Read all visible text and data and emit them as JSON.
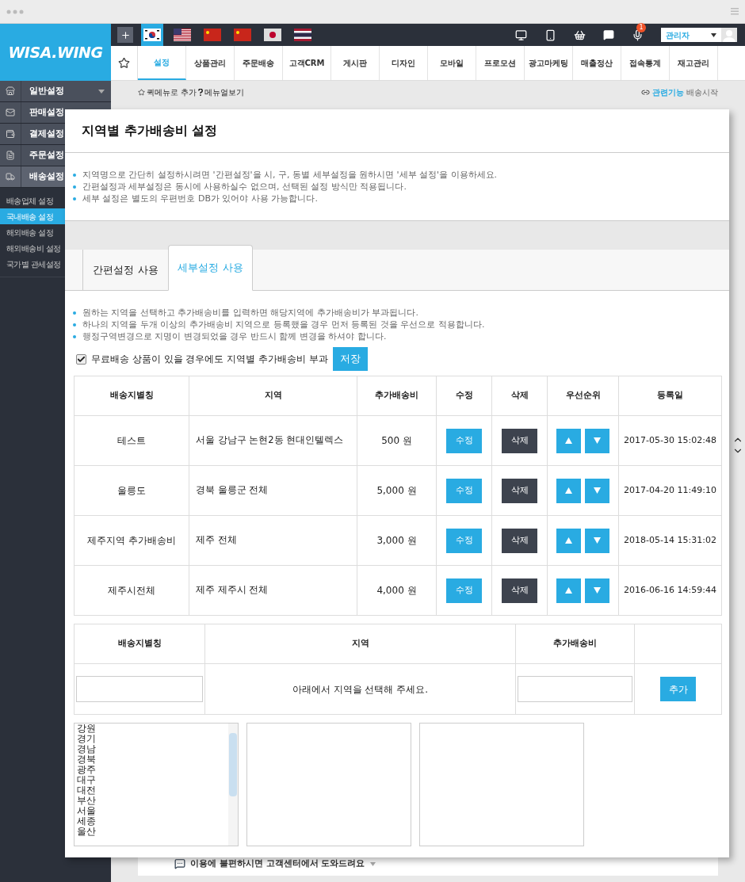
{
  "logo": "WISA.WING",
  "flags": [
    {
      "kind": "kr",
      "selected": true
    },
    {
      "kind": "us",
      "selected": false
    },
    {
      "kind": "cn",
      "selected": false
    },
    {
      "kind": "cn",
      "selected": false
    },
    {
      "kind": "jp",
      "selected": false
    },
    {
      "kind": "th",
      "selected": false
    }
  ],
  "notification_count": "1",
  "admin_select": {
    "value": "관리자"
  },
  "menu_tabs": [
    {
      "label": "설정",
      "selected": true
    },
    {
      "label": "상품관리",
      "selected": false
    },
    {
      "label": "주문배송",
      "selected": false
    },
    {
      "label": "고객CRM",
      "selected": false
    },
    {
      "label": "게시판",
      "selected": false
    },
    {
      "label": "디자인",
      "selected": false
    },
    {
      "label": "모바일",
      "selected": false
    },
    {
      "label": "프로모션",
      "selected": false
    },
    {
      "label": "광고마케팅",
      "selected": false
    },
    {
      "label": "매출정산",
      "selected": false
    },
    {
      "label": "접속통계",
      "selected": false
    },
    {
      "label": "재고관리",
      "selected": false
    }
  ],
  "quick_menu": {
    "add": "퀵메뉴로 추가",
    "help": "메뉴얼보기"
  },
  "related": {
    "label": "관련기능",
    "link": "배송시작"
  },
  "sidebar": {
    "items": [
      {
        "kind": "store",
        "label": "일반설정",
        "selected": false
      },
      {
        "kind": "mail",
        "label": "판매설정",
        "selected": false
      },
      {
        "kind": "wallet",
        "label": "결제설정",
        "selected": false
      },
      {
        "kind": "doc",
        "label": "주문설정",
        "selected": false
      },
      {
        "kind": "truck",
        "label": "배송설정",
        "selected": true
      }
    ],
    "sub_items": [
      {
        "label": "배송업체 설정",
        "selected": false
      },
      {
        "label": "국내배송 설정",
        "selected": true
      },
      {
        "label": "해외배송 설정",
        "selected": false
      },
      {
        "label": "해외배송비 설정",
        "selected": false
      },
      {
        "label": "국가별 관세설정",
        "selected": false
      }
    ]
  },
  "modal": {
    "title": "지역별 추가배송비 설정",
    "notes": [
      "지역명으로 간단히 설정하시려면 '간편설정'을 시, 구, 동별 세부설정을 원하시면 '세부 설정'을 이용하세요.",
      "간편설정과 세부설정은 동시에 사용하실수 없으며, 선택된 설정 방식만 적용됩니다.",
      "세부 설정은 별도의 우편번호 DB가 있어야 사용 가능합니다."
    ],
    "tabs": [
      {
        "label": "간편설정 사용",
        "selected": false
      },
      {
        "label": "세부설정 사용",
        "selected": true
      }
    ],
    "tab_notes": [
      "원하는 지역을 선택하고 추가배송비를 입력하면 해당지역에 추가배송비가 부과됩니다.",
      "하나의 지역을 두개 이상의 추가배송비 지역으로 등록했을 경우 먼저 등록된 것을 우선으로 적용합니다.",
      "행정구역변경으로 지명이 변경되었을 경우 반드시 함께 변경을 하셔야 합니다."
    ],
    "free_shipping_option": {
      "label": "무료배송 상품이 있을 경우에도 지역별 추가배송비 부과",
      "checked": true
    },
    "save_button": "저장",
    "table": {
      "columns": [
        "배송지별칭",
        "지역",
        "추가배송비",
        "수정",
        "삭제",
        "우선순위",
        "등록일"
      ],
      "rows": [
        {
          "alias": "테스트",
          "region": "서울 강남구 논현2동 현대인텔렉스",
          "fee": "500 원",
          "edit": "수정",
          "delete": "삭제",
          "date": "2017-05-30 15:02:48"
        },
        {
          "alias": "울릉도",
          "region": "경북 울릉군 전체",
          "fee": "5,000 원",
          "edit": "수정",
          "delete": "삭제",
          "date": "2017-04-20 11:49:10"
        },
        {
          "alias": "제주지역 추가배송비",
          "region": "제주 전체",
          "fee": "3,000 원",
          "edit": "수정",
          "delete": "삭제",
          "date": "2018-05-14 15:31:02"
        },
        {
          "alias": "제주시전체",
          "region": "제주 제주시 전체",
          "fee": "4,000 원",
          "edit": "수정",
          "delete": "삭제",
          "date": "2016-06-16 14:59:44"
        }
      ]
    },
    "add_form": {
      "columns": [
        "배송지별칭",
        "지역",
        "추가배송비"
      ],
      "region_hint": "아래에서 지역을 선택해 주세요.",
      "add_button": "추가"
    },
    "region_list": [
      "강원",
      "경기",
      "경남",
      "경북",
      "광주",
      "대구",
      "대전",
      "부산",
      "서울",
      "세종",
      "울산"
    ]
  },
  "footer": "이용에 불편하시면 고객센터에서 도와드려요"
}
